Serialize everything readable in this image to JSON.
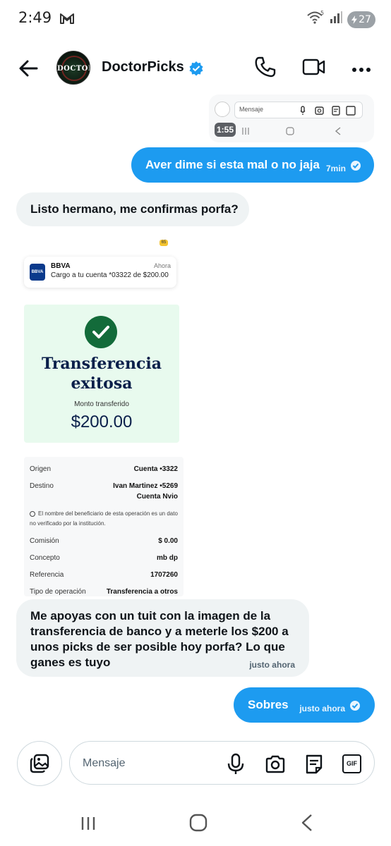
{
  "status_bar": {
    "time": "2:49",
    "battery": "27",
    "signal_label": "5"
  },
  "header": {
    "contact_name": "DoctorPicks",
    "avatar_text": "DOCTOR"
  },
  "messages": {
    "screenshot": {
      "placeholder": "Mensaje",
      "time": "1:55"
    },
    "sent_1": {
      "text": "Aver dime si esta mal o no jaja",
      "time": "7min"
    },
    "received_1": {
      "text": "Listo hermano, me confirmas porfa?"
    },
    "receipt": {
      "badge": "65",
      "notification": {
        "bank_logo": "BBVA",
        "title": "BBVA",
        "body": "Cargo a tu cuenta *03322 de $200.00",
        "time": "Ahora"
      },
      "success_title_line1": "Transferencia",
      "success_title_line2": "exitosa",
      "amount_label": "Monto transferido",
      "amount_value": "$200.00",
      "details": {
        "origen_label": "Origen",
        "origen_value": "Cuenta •3322",
        "destino_label": "Destino",
        "destino_value_1": "Ivan Martinez •5269",
        "destino_value_2": "Cuenta Nvio",
        "note": "El nombre del beneficiario de esta operación es un dato no verificado por la institución.",
        "comision_label": "Comisión",
        "comision_value": "$ 0.00",
        "concepto_label": "Concepto",
        "concepto_value": "mb dp",
        "referencia_label": "Referencia",
        "referencia_value": "1707260",
        "tipo_label": "Tipo de operación",
        "tipo_value": "Transferencia a otros"
      }
    },
    "received_2": {
      "text": "Me apoyas con un tuit con la imagen de la transferencia de banco y a meterle los $200 a unos picks de ser posible hoy porfa? Lo que ganes es tuyo",
      "time": "justo ahora"
    },
    "sent_2": {
      "text": "Sobres",
      "time": "justo ahora"
    }
  },
  "composer": {
    "placeholder": "Mensaje",
    "gif_label": "GIF"
  },
  "colors": {
    "accent": "#1d9bf0",
    "received_bubble": "#eff3f4",
    "success_green": "#136b3a"
  }
}
